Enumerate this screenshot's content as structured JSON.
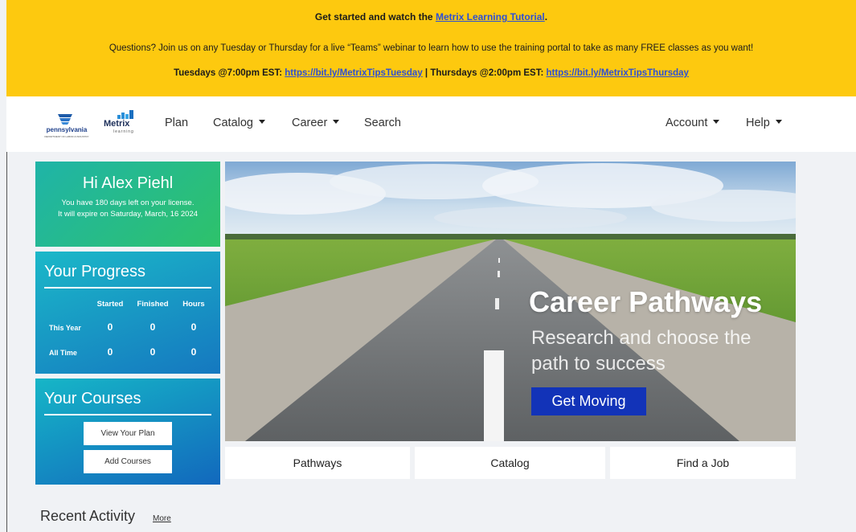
{
  "banner": {
    "line1_prefix": "Get started and watch the",
    "line1_link": "Metrix Learning Tutorial",
    "line1_suffix": ".",
    "line2": "Questions? Join us on any Tuesday or Thursday for a live “Teams” webinar to learn how to use the training portal to take as many FREE classes as you want!",
    "tue_label": "Tuesdays @7:00pm EST:",
    "tue_link": "https://bit.ly/MetrixTipsTuesday",
    "separator": " | ",
    "thu_label": "Thursdays @2:00pm EST:",
    "thu_link": "https://bit.ly/MetrixTipsThursday",
    "bg_color": "#fdc90f",
    "link_color": "#2d4fd4"
  },
  "nav": {
    "pa_logo_text": "pennsylvania",
    "pa_logo_sub": "DEPARTMENT OF LABOR & INDUSTRY",
    "metrix_logo_text": "Metrix",
    "metrix_logo_sub": "learning",
    "plan": "Plan",
    "catalog": "Catalog",
    "career": "Career",
    "search": "Search",
    "account": "Account",
    "help": "Help"
  },
  "greeting": {
    "name": "Hi Alex Piehl",
    "line1": "You have 180 days left on your license.",
    "line2": "It will expire on Saturday, March, 16 2024"
  },
  "progress": {
    "title": "Your Progress",
    "columns": [
      "Started",
      "Finished",
      "Hours"
    ],
    "rows": [
      {
        "label": "This Year",
        "values": [
          "0",
          "0",
          "0"
        ]
      },
      {
        "label": "All Time",
        "values": [
          "0",
          "0",
          "0"
        ]
      }
    ]
  },
  "courses": {
    "title": "Your Courses",
    "view_plan": "View Your Plan",
    "add_courses": "Add Courses"
  },
  "hero": {
    "title": "Career Pathways",
    "subtitle": "Research and choose the path to success",
    "cta": "Get Moving",
    "cta_color": "#1233b8"
  },
  "tiles": {
    "pathways": "Pathways",
    "catalog": "Catalog",
    "find_job": "Find a Job"
  },
  "recent": {
    "title": "Recent Activity",
    "more": "More"
  }
}
